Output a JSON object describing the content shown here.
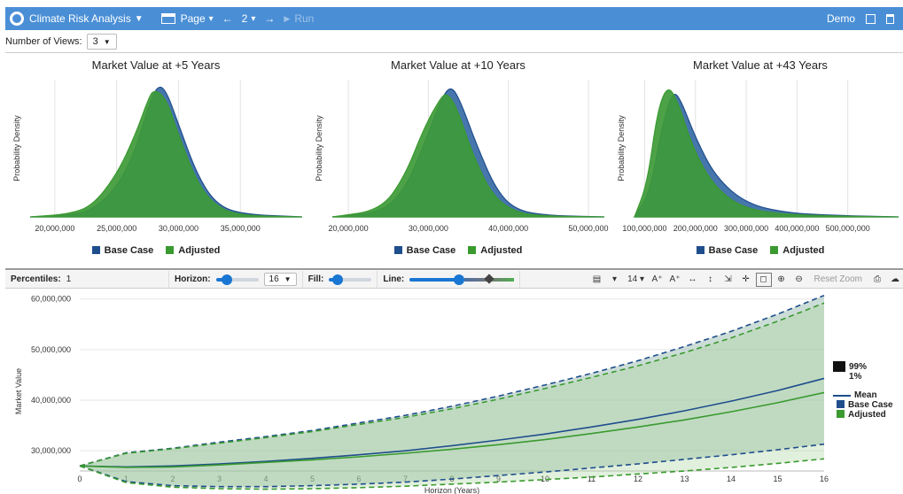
{
  "header": {
    "app_title": "Climate Risk Analysis",
    "page_label": "Page",
    "page_number": "2",
    "run_label": "Run",
    "user": "Demo",
    "bar_color": "#4a8fd6",
    "icons": [
      "globe-icon",
      "film-icon",
      "arrow-left-icon",
      "arrow-right-icon",
      "play-icon",
      "copy-icon",
      "trash-icon"
    ]
  },
  "views": {
    "label": "Number of Views:",
    "value": "3"
  },
  "legend": {
    "base": "Base Case",
    "adjusted": "Adjusted",
    "base_color": "#1f4e8c",
    "adj_color": "#3a9a2f",
    "mean": "Mean",
    "p99": "99%",
    "p1": "1%"
  },
  "chart_data": [
    {
      "type": "area",
      "title": "Market Value at +5 Years",
      "ylabel": "Probability Density",
      "xticks": [
        "20,000,000",
        "25,000,000",
        "30,000,000",
        "35,000,000"
      ],
      "xlim": [
        18000000,
        40000000
      ],
      "series": [
        {
          "name": "Base Case",
          "values": [
            [
              18000000,
              0
            ],
            [
              21000000,
              0.01
            ],
            [
              23000000,
              0.05
            ],
            [
              25000000,
              0.22
            ],
            [
              26500000,
              0.5
            ],
            [
              27500000,
              0.82
            ],
            [
              28300000,
              1.0
            ],
            [
              29000000,
              0.96
            ],
            [
              30000000,
              0.7
            ],
            [
              31500000,
              0.32
            ],
            [
              33000000,
              0.1
            ],
            [
              35000000,
              0.02
            ],
            [
              40000000,
              0
            ]
          ]
        },
        {
          "name": "Adjusted",
          "values": [
            [
              18000000,
              0
            ],
            [
              21000000,
              0.02
            ],
            [
              23000000,
              0.08
            ],
            [
              25000000,
              0.32
            ],
            [
              26500000,
              0.62
            ],
            [
              27500000,
              0.88
            ],
            [
              28000000,
              0.97
            ],
            [
              29000000,
              0.9
            ],
            [
              30000000,
              0.62
            ],
            [
              31500000,
              0.26
            ],
            [
              33000000,
              0.08
            ],
            [
              35000000,
              0.01
            ],
            [
              40000000,
              0
            ]
          ]
        }
      ]
    },
    {
      "type": "area",
      "title": "Market Value at +10 Years",
      "ylabel": "Probability Density",
      "xticks": [
        "20,000,000",
        "30,000,000",
        "40,000,000",
        "50,000,000"
      ],
      "xlim": [
        18000000,
        52000000
      ],
      "series": [
        {
          "name": "Base Case",
          "values": [
            [
              18000000,
              0
            ],
            [
              24000000,
              0.03
            ],
            [
              27000000,
              0.2
            ],
            [
              29500000,
              0.55
            ],
            [
              31500000,
              0.88
            ],
            [
              32800000,
              1.0
            ],
            [
              34000000,
              0.88
            ],
            [
              36000000,
              0.55
            ],
            [
              38500000,
              0.2
            ],
            [
              41000000,
              0.05
            ],
            [
              45000000,
              0.01
            ],
            [
              52000000,
              0
            ]
          ]
        },
        {
          "name": "Adjusted",
          "values": [
            [
              18000000,
              0
            ],
            [
              24000000,
              0.05
            ],
            [
              27000000,
              0.3
            ],
            [
              29500000,
              0.68
            ],
            [
              31500000,
              0.9
            ],
            [
              32300000,
              0.94
            ],
            [
              33500000,
              0.84
            ],
            [
              35500000,
              0.48
            ],
            [
              38000000,
              0.16
            ],
            [
              41000000,
              0.03
            ],
            [
              45000000,
              0.005
            ],
            [
              52000000,
              0
            ]
          ]
        }
      ]
    },
    {
      "type": "area",
      "title": "Market Value at +43 Years",
      "ylabel": "Probability Density",
      "xticks": [
        "100,000,000",
        "200,000,000",
        "300,000,000",
        "400,000,000",
        "500,000,000"
      ],
      "xlim": [
        80000000,
        600000000
      ],
      "series": [
        {
          "name": "Base Case",
          "values": [
            [
              80000000,
              0
            ],
            [
              110000000,
              0.18
            ],
            [
              135000000,
              0.7
            ],
            [
              155000000,
              0.95
            ],
            [
              170000000,
              0.9
            ],
            [
              200000000,
              0.6
            ],
            [
              240000000,
              0.3
            ],
            [
              300000000,
              0.1
            ],
            [
              380000000,
              0.03
            ],
            [
              480000000,
              0.01
            ],
            [
              600000000,
              0
            ]
          ]
        },
        {
          "name": "Adjusted",
          "values": [
            [
              80000000,
              0
            ],
            [
              105000000,
              0.25
            ],
            [
              125000000,
              0.8
            ],
            [
              145000000,
              1.0
            ],
            [
              165000000,
              0.88
            ],
            [
              195000000,
              0.52
            ],
            [
              235000000,
              0.24
            ],
            [
              290000000,
              0.07
            ],
            [
              370000000,
              0.02
            ],
            [
              480000000,
              0.005
            ],
            [
              600000000,
              0
            ]
          ]
        }
      ]
    },
    {
      "type": "line",
      "xlabel": "Horizon (Years)",
      "ylabel": "Market Value",
      "x": [
        0,
        1,
        2,
        3,
        4,
        5,
        6,
        7,
        8,
        9,
        10,
        11,
        12,
        13,
        14,
        15,
        16
      ],
      "ylim": [
        26000000,
        61000000
      ],
      "yticks": [
        "30,000,000",
        "40,000,000",
        "50,000,000",
        "60,000,000"
      ],
      "series": [
        {
          "name": "Base Case 99%",
          "values": [
            27000000,
            29600000,
            30500000,
            31700000,
            32800000,
            34000000,
            35500000,
            37000000,
            38800000,
            40800000,
            43000000,
            45300000,
            47800000,
            50600000,
            53600000,
            57000000,
            60700000
          ]
        },
        {
          "name": "Adjusted 99%",
          "values": [
            27000000,
            29500000,
            30400000,
            31500000,
            32600000,
            33800000,
            35200000,
            36600000,
            38300000,
            40200000,
            42300000,
            44500000,
            46800000,
            49400000,
            52300000,
            55600000,
            59200000
          ]
        },
        {
          "name": "Base Case Mean",
          "values": [
            27000000,
            26800000,
            27000000,
            27400000,
            27900000,
            28500000,
            29200000,
            30000000,
            31000000,
            32100000,
            33300000,
            34700000,
            36200000,
            37900000,
            39800000,
            41900000,
            44300000
          ]
        },
        {
          "name": "Adjusted Mean",
          "values": [
            27000000,
            26700000,
            26800000,
            27200000,
            27700000,
            28200000,
            28800000,
            29500000,
            30300000,
            31200000,
            32200000,
            33400000,
            34700000,
            36100000,
            37700000,
            39500000,
            41500000
          ]
        },
        {
          "name": "Base Case 1%",
          "values": [
            27000000,
            23900000,
            23100000,
            22900000,
            22900000,
            23100000,
            23400000,
            23800000,
            24400000,
            25100000,
            25800000,
            26600000,
            27400000,
            28300000,
            29200000,
            30200000,
            31300000
          ]
        },
        {
          "name": "Adjusted 1%",
          "values": [
            27000000,
            23700000,
            22800000,
            22500000,
            22400000,
            22500000,
            22700000,
            23000000,
            23400000,
            23800000,
            24300000,
            24800000,
            25400000,
            26000000,
            26700000,
            27500000,
            28400000
          ]
        }
      ]
    }
  ],
  "toolbar": {
    "percentiles_label": "Percentiles:",
    "percentiles_value": "1",
    "horizon_label": "Horizon:",
    "horizon_value": "16",
    "horizon_level": 0.25,
    "fill_label": "Fill:",
    "fill_level": 0.2,
    "line_label": "Line:",
    "line_level": 1.0,
    "font_size": "14",
    "reset_label": "Reset Zoom"
  }
}
